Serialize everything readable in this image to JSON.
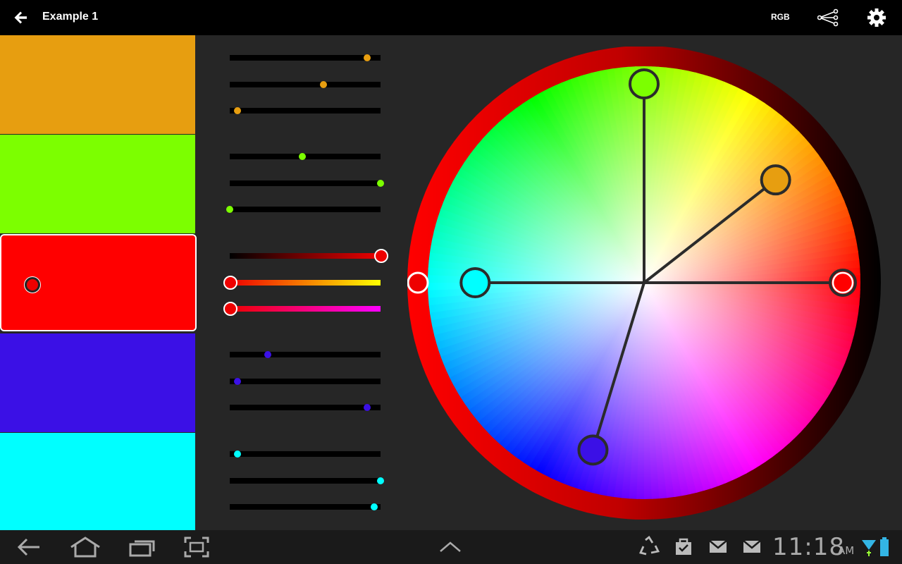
{
  "actionbar": {
    "title": "Example 1",
    "mode_label": "RGB"
  },
  "swatches": [
    {
      "color": "#E79E10",
      "selected": false
    },
    {
      "color": "#7CFF00",
      "selected": false
    },
    {
      "color": "#FF0000",
      "selected": true
    },
    {
      "color": "#3B10E6",
      "selected": false
    },
    {
      "color": "#00FFFF",
      "selected": false
    }
  ],
  "slider_groups": [
    {
      "color": "#E79E10",
      "values": [
        0.91,
        0.62,
        0.05
      ]
    },
    {
      "color": "#7CFF00",
      "values": [
        0.48,
        1.0,
        0.0
      ]
    },
    {
      "color": "#FF0000",
      "values": [
        1.0,
        0.0,
        0.0
      ]
    },
    {
      "color": "#3B10E6",
      "values": [
        0.25,
        0.05,
        0.91
      ]
    },
    {
      "color": "#00FFFF",
      "values": [
        0.05,
        1.0,
        0.96
      ]
    }
  ],
  "wheel": {
    "brightness": 1.0,
    "handles": [
      {
        "name": "red",
        "color": "#FF0000",
        "hue": 0,
        "saturation": 1.0,
        "active": true
      },
      {
        "name": "orange",
        "color": "#E79E10",
        "hue": 38,
        "saturation": 0.84
      },
      {
        "name": "green",
        "color": "#7CFF00",
        "hue": 90,
        "saturation": 1.0
      },
      {
        "name": "cyan",
        "color": "#00FFFF",
        "hue": 180,
        "saturation": 0.85
      },
      {
        "name": "blue",
        "color": "#3B10E6",
        "hue": 253,
        "saturation": 0.88
      }
    ]
  },
  "status": {
    "time": "11:18",
    "ampm": "AM"
  }
}
